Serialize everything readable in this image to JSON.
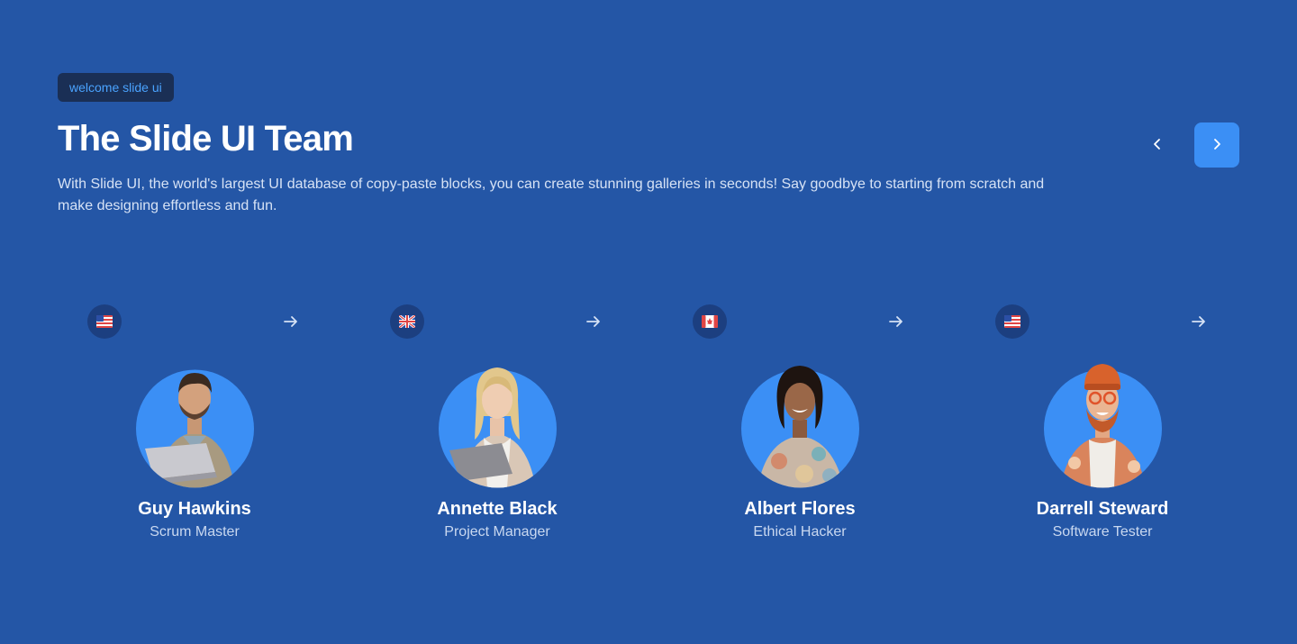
{
  "header": {
    "badge": "welcome slide ui",
    "title": "The Slide UI Team",
    "description": "With Slide UI, the world's largest UI database of copy-paste blocks, you can create stunning galleries in seconds! Say goodbye to starting from scratch and make designing effortless and fun."
  },
  "navigation": {
    "prev_icon": "chevron-left-icon",
    "next_icon": "chevron-right-icon"
  },
  "colors": {
    "background": "#2456a6",
    "accent": "#3b8ff5",
    "badge_bg": "#1a2f55",
    "badge_text": "#4aa3ff",
    "flag_bg": "#1c3f80",
    "avatar_bg": "#3b8ff5"
  },
  "team": [
    {
      "name": "Guy Hawkins",
      "role": "Scrum Master",
      "flag": "us-flag-icon"
    },
    {
      "name": "Annette Black",
      "role": "Project Manager",
      "flag": "uk-flag-icon"
    },
    {
      "name": "Albert Flores",
      "role": "Ethical Hacker",
      "flag": "ca-flag-icon"
    },
    {
      "name": "Darrell Steward",
      "role": "Software Tester",
      "flag": "us-flag-icon"
    }
  ]
}
